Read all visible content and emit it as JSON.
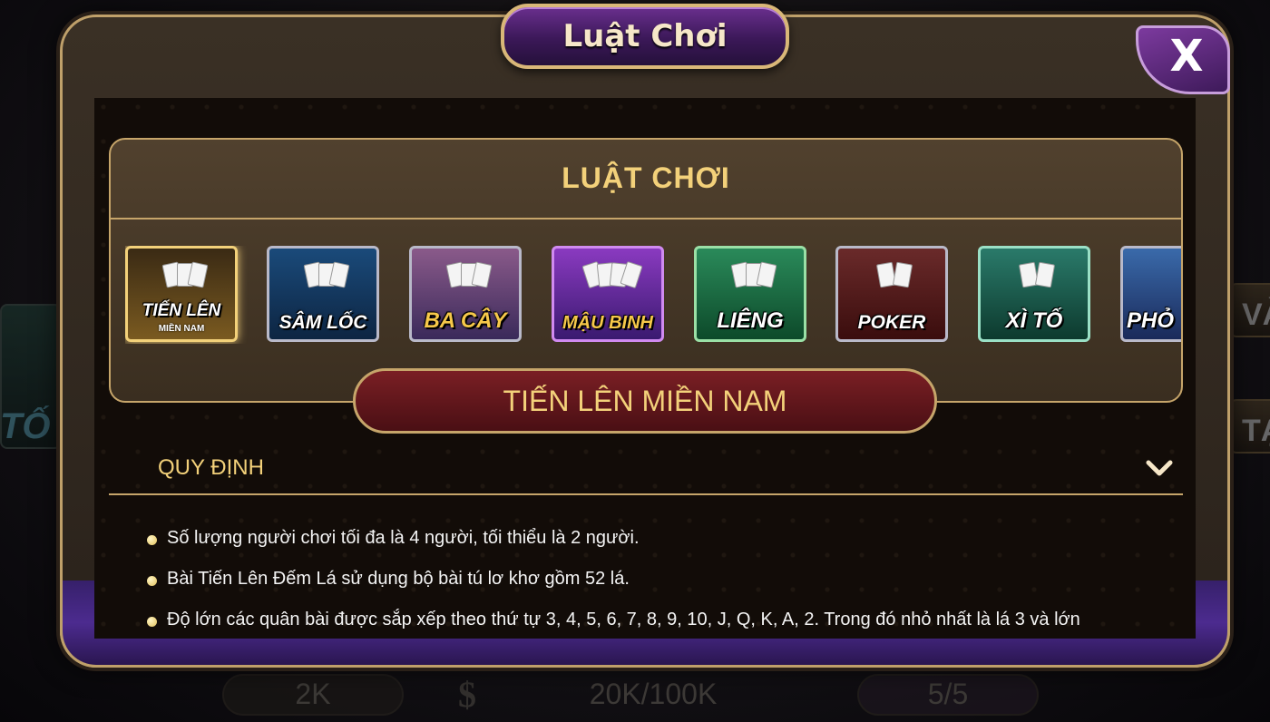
{
  "background": {
    "left_text": "TỐ",
    "right_buttons": [
      "VÀ",
      "TẠ"
    ],
    "bottom_values": [
      "2K",
      "$",
      "20K/100K",
      "5/5"
    ]
  },
  "dialog": {
    "title": "Luật Chơi",
    "close_label": "X"
  },
  "rules_panel": {
    "title": "LUẬT CHƠI"
  },
  "games": [
    {
      "label": "TIẾN LÊN",
      "sub": "MIỀN NAM",
      "color_top": "#3a2a14",
      "color_bottom": "#7a5a20"
    },
    {
      "label": "SÂM LỐC",
      "sub": "",
      "color_top": "#1a4a7a",
      "color_bottom": "#0d2542"
    },
    {
      "label": "BA CÂY",
      "sub": "",
      "color_top": "#8a5a8a",
      "color_bottom": "#3a2a5a"
    },
    {
      "label": "MẬU BINH",
      "sub": "",
      "color_top": "#8a3ac0",
      "color_bottom": "#3a1a70"
    },
    {
      "label": "LIÊNG",
      "sub": "",
      "color_top": "#2a8a5a",
      "color_bottom": "#0d4a2a"
    },
    {
      "label": "POKER",
      "sub": "",
      "color_top": "#6a2a2a",
      "color_bottom": "#3a0d0d"
    },
    {
      "label": "XÌ TỐ",
      "sub": "",
      "color_top": "#2a7a6a",
      "color_bottom": "#0d3a2e"
    },
    {
      "label": "PHỎ",
      "sub": "",
      "color_top": "#3a6aaa",
      "color_bottom": "#1a2a5a"
    }
  ],
  "selected_game": "TIẾN LÊN MIỀN NAM",
  "section": {
    "label": "QUY ĐỊNH",
    "expanded": true
  },
  "rules": [
    "Số lượng người chơi tối đa là 4 người, tối thiểu là 2 người.",
    "Bài Tiến Lên Đếm Lá sử dụng bộ bài tú lơ khơ gồm 52 lá.",
    "Độ lớn các quân bài được sắp xếp theo thứ tự 3, 4, 5, 6, 7, 8, 9, 10, J, Q, K, A, 2. Trong đó nhỏ nhất là lá 3 và lớn"
  ],
  "colors": {
    "gold": "#f3d17a",
    "border_gold": "#c6a56a",
    "purple": "#4c2b8f",
    "banner_red": "#7a1f24"
  }
}
